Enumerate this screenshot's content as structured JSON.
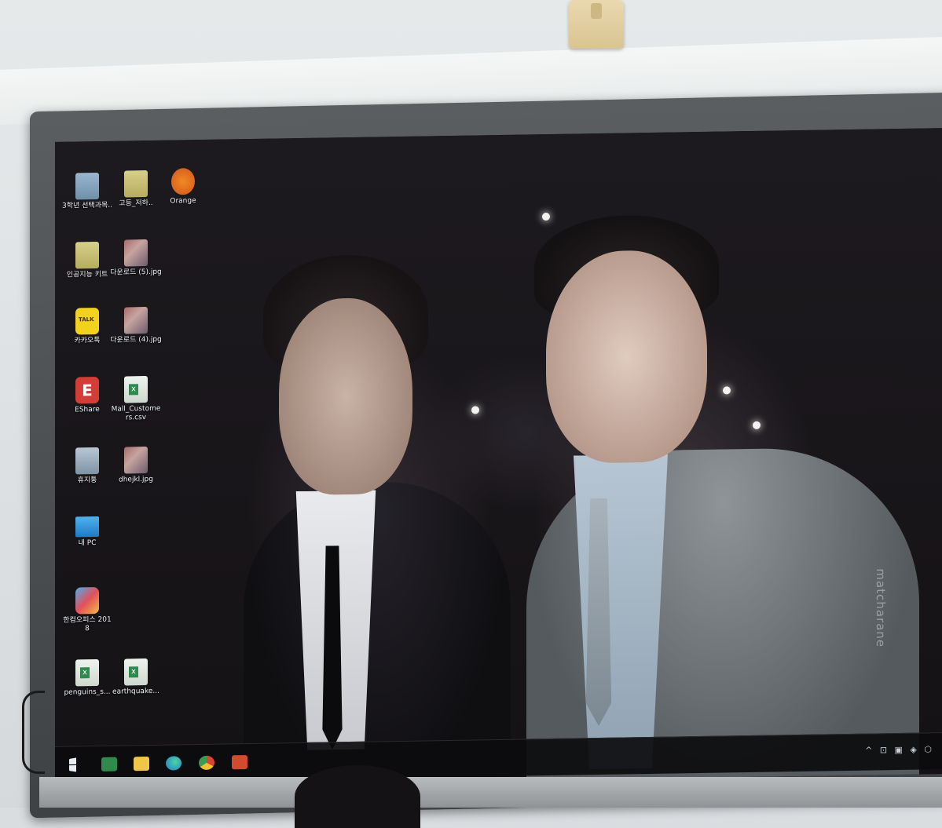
{
  "desktop": {
    "icons": [
      {
        "label": "3학년 선택과목..",
        "type": "folder"
      },
      {
        "label": "고등_저하..",
        "type": "folder"
      },
      {
        "label": "Orange",
        "type": "app"
      },
      {
        "label": "인공지능 키트",
        "type": "folder"
      },
      {
        "label": "다운로드 (5).jpg",
        "type": "image"
      },
      {
        "label": "카카오톡",
        "type": "app"
      },
      {
        "label": "다운로드 (4).jpg",
        "type": "image"
      },
      {
        "label": "EShare",
        "type": "app"
      },
      {
        "label": "Mall_Customers.csv",
        "type": "spreadsheet"
      },
      {
        "label": "휴지통",
        "type": "recycle-bin"
      },
      {
        "label": "dhejkl.jpg",
        "type": "image"
      },
      {
        "label": "내 PC",
        "type": "this-pc"
      },
      {
        "label": "한컴오피스 2018",
        "type": "app"
      },
      {
        "label": "penguins_s...",
        "type": "spreadsheet"
      },
      {
        "label": "earthquake...",
        "type": "spreadsheet"
      }
    ]
  },
  "wallpaper": {
    "watermark": "matcharane"
  },
  "taskbar": {
    "apps": [
      "start-icon",
      "excel-icon",
      "file-explorer-icon",
      "edge-icon",
      "chrome-icon",
      "powerpoint-icon"
    ],
    "tray": "^ ⊡ ▣ ◈ ⬡"
  }
}
